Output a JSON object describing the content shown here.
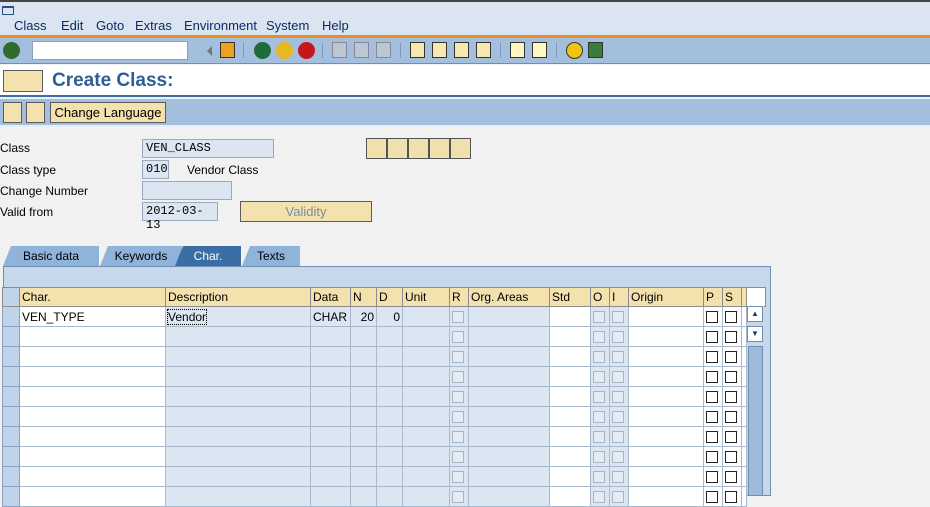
{
  "menu": [
    "Class",
    "Edit",
    "Goto",
    "Extras",
    "Environment",
    "System",
    "Help"
  ],
  "title": "Create Class:",
  "app_toolbar": {
    "change_language": "Change Language"
  },
  "form": {
    "class_label": "Class",
    "class_value": "VEN_CLASS",
    "class_type_label": "Class type",
    "class_type_value": "010",
    "class_type_desc": "Vendor Class",
    "change_number_label": "Change Number",
    "change_number_value": "",
    "valid_from_label": "Valid from",
    "valid_from_value": "2012-03-13",
    "validity_button": "Validity"
  },
  "tabs": [
    {
      "label": "Basic data"
    },
    {
      "label": "Keywords"
    },
    {
      "label": "Char.",
      "active": true
    },
    {
      "label": "Texts"
    }
  ],
  "table": {
    "columns": [
      "Char.",
      "Description",
      "Data",
      "N",
      "D",
      "Unit",
      "R",
      "Org. Areas",
      "Std",
      "O",
      "I",
      "Origin",
      "P",
      "S"
    ],
    "rows": [
      {
        "char": "VEN_TYPE",
        "description": "Vendor",
        "data": "CHAR",
        "n": "20",
        "d": "0"
      }
    ]
  },
  "colors": {
    "accent": "#f08c1a",
    "toolbar": "#a3bfdd",
    "title": "#2e5f94"
  }
}
